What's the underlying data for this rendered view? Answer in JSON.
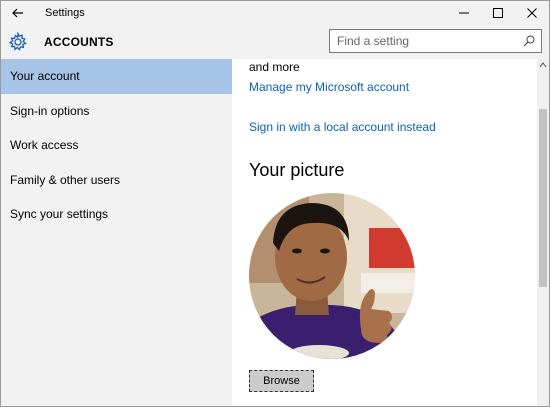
{
  "window": {
    "title": "Settings"
  },
  "header": {
    "section": "ACCOUNTS",
    "search_placeholder": "Find a setting"
  },
  "sidebar": {
    "items": [
      {
        "label": "Your account"
      },
      {
        "label": "Sign-in options"
      },
      {
        "label": "Work access"
      },
      {
        "label": "Family & other users"
      },
      {
        "label": "Sync your settings"
      }
    ],
    "active_index": 0
  },
  "content": {
    "and_more": "and more",
    "manage_link": "Manage my Microsoft account",
    "local_link": "Sign in with a local account instead",
    "picture_heading": "Your picture",
    "browse_label": "Browse"
  },
  "colors": {
    "accent": "#a6c4e7",
    "link": "#0a63b8"
  },
  "icons": [
    "back-arrow-icon",
    "minimize-icon",
    "maximize-icon",
    "close-icon",
    "gear-icon",
    "search-icon"
  ]
}
